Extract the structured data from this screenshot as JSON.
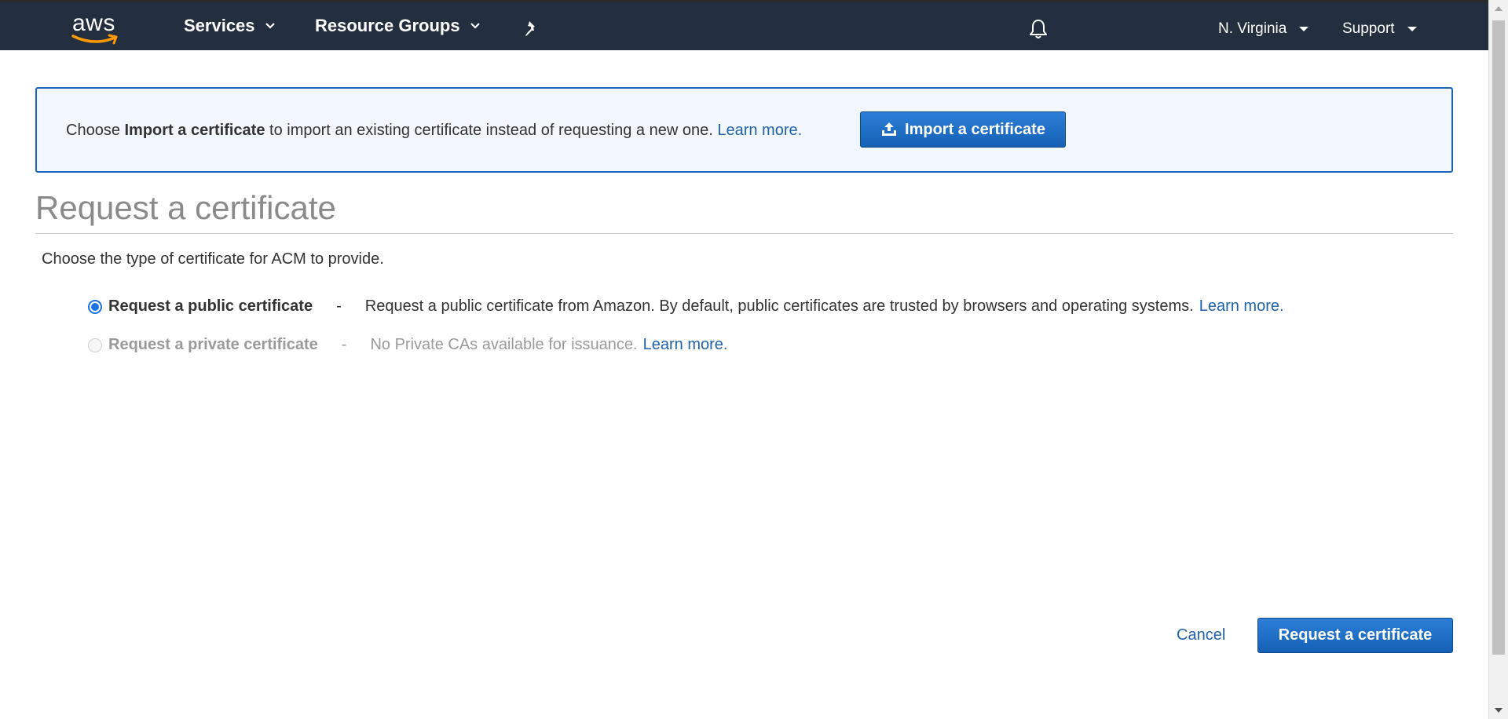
{
  "nav": {
    "logo_text": "aws",
    "services_label": "Services",
    "resource_groups_label": "Resource Groups",
    "region_label": "N. Virginia",
    "support_label": "Support",
    "icons": [
      "pin-icon",
      "bell-icon",
      "chevron-down-icon",
      "caret-down-icon"
    ]
  },
  "banner": {
    "text_before": "Choose ",
    "text_bold": "Import a certificate",
    "text_after": " to import an existing certificate instead of requesting a new one. ",
    "learn_more": "Learn more.",
    "import_button_label": "Import a certificate",
    "icon": "upload-icon"
  },
  "page": {
    "title": "Request a certificate",
    "subtitle": "Choose the type of certificate for ACM to provide."
  },
  "options": [
    {
      "label": "Request a public certificate",
      "dash": "-",
      "description": "Request a public certificate from Amazon. By default, public certificates are trusted by browsers and operating systems.",
      "learn_more": "Learn more.",
      "selected": true,
      "disabled": false
    },
    {
      "label": "Request a private certificate",
      "dash": "-",
      "description": "No Private CAs available for issuance.",
      "learn_more": "Learn more.",
      "selected": false,
      "disabled": true
    }
  ],
  "footer": {
    "cancel_label": "Cancel",
    "submit_label": "Request a certificate"
  },
  "colors": {
    "nav_bg": "#232f3e",
    "banner_bg": "#f1f7fc",
    "banner_border": "#1b66b8",
    "primary_button": "#1e6cc4",
    "link": "#1f62a8",
    "aws_smile": "#ff9900"
  }
}
